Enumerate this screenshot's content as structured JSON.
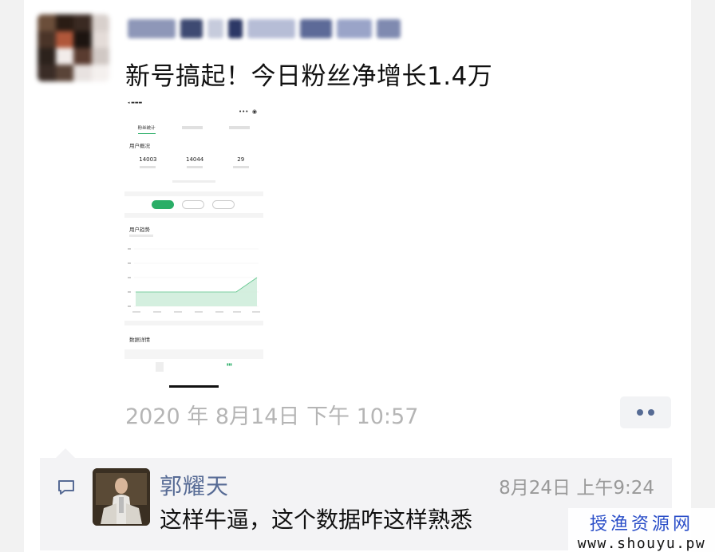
{
  "post": {
    "text": "新号搞起！今日粉丝净增长1.4万",
    "timestamp": "2020 年 8月14日 下午 10:57"
  },
  "embedded_screenshot": {
    "tabs": [
      "粉丝统计",
      "",
      ""
    ],
    "section_user_overview": "用户概况",
    "stats": [
      {
        "value": "14003",
        "label": ""
      },
      {
        "value": "14044",
        "label": ""
      },
      {
        "value": "29",
        "label": ""
      }
    ],
    "pills": [
      "",
      "",
      ""
    ],
    "section_trend": "用户趋势",
    "section_detail": "数据详情"
  },
  "comment": {
    "name": "郭耀天",
    "time": "8月24日 上午9:24",
    "text": "这样牛逼，这个数据咋这样熟悉"
  },
  "watermark": {
    "cn": "授渔资源网",
    "url": "www.shouyu.pw"
  },
  "colors": {
    "link_blue": "#576b95",
    "accent_green": "#2aae67",
    "timestamp_gray": "#b5b5b5"
  }
}
